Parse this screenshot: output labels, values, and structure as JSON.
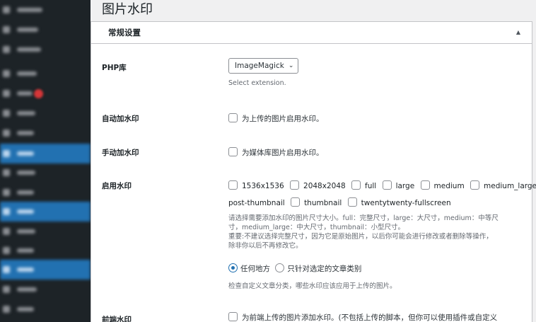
{
  "page": {
    "title": "图片水印"
  },
  "section": {
    "title": "常规设置",
    "toggle": "▲"
  },
  "php": {
    "label": "PHP库",
    "selected": "ImageMagick",
    "desc": "Select extension."
  },
  "auto": {
    "label": "自动加水印",
    "checkbox_label": "为上传的图片启用水印。"
  },
  "manual": {
    "label": "手动加水印",
    "checkbox_label": "为媒体库图片启用水印。"
  },
  "enable": {
    "label": "启用水印",
    "sizes": [
      "1536x1536",
      "2048x2048",
      "full",
      "large",
      "medium",
      "medium_large",
      "post-thumbnail",
      "thumbnail",
      "twentytwenty-fullscreen"
    ],
    "desc1": "请选择需要添加水印的图片尺寸大小。full：完整尺寸，large：大尺寸，medium：中等尺",
    "desc2": "寸，medium_large：中大尺寸，thumbnail：小型尺寸。",
    "desc3": "重要:不建议选择完整尺寸，因为它是原始图片，以后你可能会进行修改或者删除等操作，",
    "desc4": "除非你以后不再修改它。",
    "radio_any": "任何地方",
    "radio_selected": "只针对选定的文章类别",
    "radio_desc": "检查自定义文章分类，哪些水印应该应用于上传的图片。"
  },
  "frontend": {
    "label": "前端水印",
    "checkbox_label": "为前端上传的图片添加水印。(不包括上传的脚本，但你可以使用插件或自定义"
  }
}
